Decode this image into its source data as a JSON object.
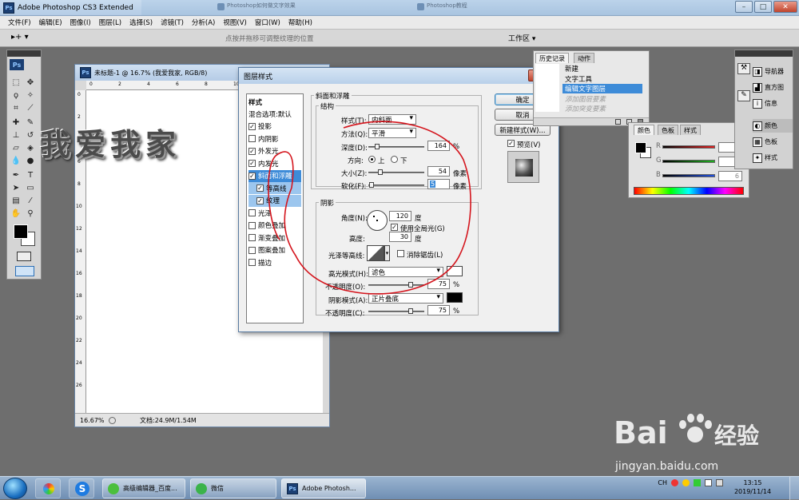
{
  "window": {
    "title": "Adobe Photoshop CS3 Extended",
    "ps_badge": "Ps",
    "min": "–",
    "max": "□",
    "close": "✕"
  },
  "browser_tabs": [
    "高级编辑器_百度经验",
    "Photoshop如何做文字效果",
    "Photoshop教程"
  ],
  "menu": [
    "文件(F)",
    "编辑(E)",
    "图像(I)",
    "图层(L)",
    "选择(S)",
    "滤镜(T)",
    "分析(A)",
    "视图(V)",
    "窗口(W)",
    "帮助(H)"
  ],
  "options_bar": {
    "tool": "▸+ ▾",
    "hint": "点按并拖移可调整纹理的位置",
    "workspace": "工作区 ▾"
  },
  "document": {
    "title": "未标题-1 @ 16.7% (我爱我家, RGB/8)",
    "canvas_text": "我爱我家",
    "zoom": "16.67%",
    "doc_size": "文档:24.9M/1.54M",
    "ruler_top": [
      "0",
      "2",
      "4",
      "6",
      "8",
      "10",
      "12",
      "14",
      "16"
    ],
    "ruler_left": [
      "0",
      "2",
      "4",
      "6",
      "8",
      "10",
      "12",
      "14",
      "16",
      "18",
      "20",
      "22",
      "24",
      "26"
    ]
  },
  "dialog": {
    "title": "图层样式",
    "close": "✕",
    "styles_header": "样式",
    "style_items": [
      {
        "label": "混合选项:默认",
        "check": false,
        "has_cb": false
      },
      {
        "label": "投影",
        "check": true,
        "has_cb": true
      },
      {
        "label": "内阴影",
        "check": false,
        "has_cb": true
      },
      {
        "label": "外发光",
        "check": true,
        "has_cb": true
      },
      {
        "label": "内发光",
        "check": true,
        "has_cb": true
      },
      {
        "label": "斜面和浮雕",
        "check": true,
        "has_cb": true
      },
      {
        "label": "等高线",
        "check": true,
        "has_cb": true
      },
      {
        "label": "纹理",
        "check": true,
        "has_cb": true
      },
      {
        "label": "光泽",
        "check": false,
        "has_cb": true
      },
      {
        "label": "颜色叠加",
        "check": false,
        "has_cb": true
      },
      {
        "label": "渐变叠加",
        "check": false,
        "has_cb": true
      },
      {
        "label": "图案叠加",
        "check": false,
        "has_cb": true
      },
      {
        "label": "描边",
        "check": false,
        "has_cb": true
      }
    ],
    "bevel": {
      "section_title": "斜面和浮雕",
      "structure_title": "结构",
      "style_label": "样式(T):",
      "style_value": "内斜面",
      "method_label": "方法(Q):",
      "method_value": "平滑",
      "depth_label": "深度(D):",
      "depth_value": "164",
      "depth_unit": "%",
      "depth_pos": 0.16,
      "direction_label": "方向:",
      "dir_up": "上",
      "dir_down": "下",
      "size_label": "大小(Z):",
      "size_value": "54",
      "size_unit": "像素",
      "size_pos": 0.22,
      "soften_label": "软化(F):",
      "soften_value": "5",
      "soften_unit": "像素",
      "soften_pos": 0.06,
      "shading_title": "阴影",
      "angle_label": "角度(N):",
      "angle_value": "120",
      "angle_unit": "度",
      "global_light": "使用全局光(G)",
      "altitude_label": "高度:",
      "altitude_value": "30",
      "altitude_unit": "度",
      "gloss_label": "光泽等高线:",
      "antialias": "消除锯齿(L)",
      "highlight_label": "高光模式(H):",
      "highlight_value": "滤色",
      "opacity_label": "不透明度(O):",
      "opacity_value": "75",
      "opacity_unit": "%",
      "opacity_pos": 0.75,
      "shadow_label": "阴影模式(A):",
      "shadow_value": "正片叠底",
      "opacity2_label": "不透明度(C):",
      "opacity2_value": "75",
      "opacity2_unit": "%",
      "opacity2_pos": 0.75
    },
    "buttons": {
      "ok": "确定",
      "cancel": "取消",
      "new_style": "新建样式(W)...",
      "preview": "预览(V)"
    }
  },
  "history": {
    "tabs": [
      "历史记录",
      "动作"
    ],
    "items": [
      {
        "label": "新建",
        "state": "normal"
      },
      {
        "label": "文字工具",
        "state": "normal"
      },
      {
        "label": "编辑文字图层",
        "state": "current"
      },
      {
        "label": "添加图层要素",
        "state": "dim"
      },
      {
        "label": "添加突变要素",
        "state": "dim"
      }
    ]
  },
  "color_panel": {
    "tabs": [
      "颜色",
      "色板",
      "样式"
    ],
    "channels": [
      {
        "label": "R",
        "value": "0",
        "color": "#e32020"
      },
      {
        "label": "G",
        "value": "4",
        "color": "#20b020"
      },
      {
        "label": "B",
        "value": "6",
        "color": "#2050e0"
      }
    ]
  },
  "right_dock": [
    "导航器",
    "直方图",
    "信息",
    "颜色",
    "色板",
    "样式"
  ],
  "taskbar": {
    "items": [
      "高级编辑器_百度...",
      "微信",
      "Adobe Photosh..."
    ],
    "lang": "CH",
    "time": "13:15",
    "date": "2019/11/14"
  },
  "watermark": {
    "brand": "Bai",
    "brand2": "经验",
    "url": "jingyan.baidu.com"
  },
  "colors": {
    "accent": "#3d8bd8",
    "annotation": "#d4141c"
  }
}
